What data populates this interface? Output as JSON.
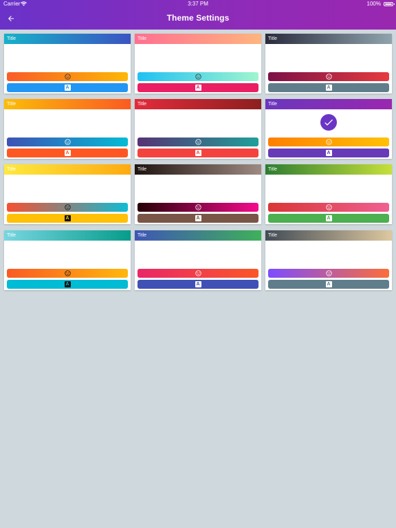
{
  "status": {
    "carrier": "Carrier",
    "time": "3:37 PM",
    "battery": "100%"
  },
  "header": {
    "title": "Theme Settings",
    "back_icon": "arrow-back-icon"
  },
  "themes": [
    {
      "title": "Title",
      "selected": false,
      "title_gradient": [
        "#17b1c9",
        "#3b54c2"
      ],
      "title_text": "#ffffff",
      "top_gradient": [
        "#f95c28",
        "#fdb706"
      ],
      "top_icon_color": "#333333",
      "bottom_gradient": [
        "#2196f3",
        "#2196f3"
      ],
      "bottom_icon_bg": "#ffffff",
      "bottom_icon_fg": "#2196f3"
    },
    {
      "title": "Title",
      "selected": false,
      "title_gradient": [
        "#ff6f91",
        "#ffb57f"
      ],
      "title_text": "#ffffff",
      "top_gradient": [
        "#21c1f3",
        "#9ff5cf"
      ],
      "top_icon_color": "#333333",
      "bottom_gradient": [
        "#e91e63",
        "#e91e63"
      ],
      "bottom_icon_bg": "#ffffff",
      "bottom_icon_fg": "#e91e63"
    },
    {
      "title": "Title",
      "selected": false,
      "title_gradient": [
        "#2a2b3c",
        "#90a4ae"
      ],
      "title_text": "#ffffff",
      "top_gradient": [
        "#7b1147",
        "#e63a3f"
      ],
      "top_icon_color": "#ffffff",
      "bottom_gradient": [
        "#607d8b",
        "#607d8b"
      ],
      "bottom_icon_bg": "#ffffff",
      "bottom_icon_fg": "#607d8b"
    },
    {
      "title": "Title",
      "selected": false,
      "title_gradient": [
        "#fbbd08",
        "#fb5a22"
      ],
      "title_text": "#ffffff",
      "top_gradient": [
        "#3f51b5",
        "#03bcd4"
      ],
      "top_icon_color": "#ffffff",
      "bottom_gradient": [
        "#ff5722",
        "#ff5722"
      ],
      "bottom_icon_bg": "#ffffff",
      "bottom_icon_fg": "#ff5722"
    },
    {
      "title": "Title",
      "selected": false,
      "title_gradient": [
        "#e32b3b",
        "#8d1f1f"
      ],
      "title_text": "#ffffff",
      "top_gradient": [
        "#563274",
        "#20a09a"
      ],
      "top_icon_color": "#ffffff",
      "bottom_gradient": [
        "#f4433e",
        "#f4433e"
      ],
      "bottom_icon_bg": "#ffffff",
      "bottom_icon_fg": "#f4433e"
    },
    {
      "title": "Title",
      "selected": true,
      "title_gradient": [
        "#6a37bd",
        "#9b27b0"
      ],
      "title_text": "#ffffff",
      "top_gradient": [
        "#fd7f01",
        "#ffc107"
      ],
      "top_icon_color": "#ffffff",
      "bottom_gradient": [
        "#673ab7",
        "#673ab7"
      ],
      "bottom_icon_bg": "#ffffff",
      "bottom_icon_fg": "#673ab7"
    },
    {
      "title": "Title",
      "selected": false,
      "title_gradient": [
        "#fde940",
        "#fdaa10"
      ],
      "title_text": "#ffffff",
      "top_gradient": [
        "#f75030",
        "#10bcd4"
      ],
      "top_icon_color": "#111111",
      "bottom_gradient": [
        "#ffc107",
        "#ffc107"
      ],
      "bottom_icon_bg": "#111111",
      "bottom_icon_fg": "#ffc107"
    },
    {
      "title": "Title",
      "selected": false,
      "title_gradient": [
        "#1f1410",
        "#9e8a82"
      ],
      "title_text": "#ffffff",
      "top_gradient": [
        "#270007",
        "#f50b8d"
      ],
      "top_icon_color": "#ffffff",
      "bottom_gradient": [
        "#795548",
        "#795548"
      ],
      "bottom_icon_bg": "#ffffff",
      "bottom_icon_fg": "#795548"
    },
    {
      "title": "Title",
      "selected": false,
      "title_gradient": [
        "#2e7d32",
        "#c6e03a"
      ],
      "title_text": "#ffffff",
      "top_gradient": [
        "#d93636",
        "#ef6191"
      ],
      "top_icon_color": "#ffffff",
      "bottom_gradient": [
        "#4caf50",
        "#4caf50"
      ],
      "bottom_icon_bg": "#ffffff",
      "bottom_icon_fg": "#4caf50"
    },
    {
      "title": "Title",
      "selected": false,
      "title_gradient": [
        "#78d6e0",
        "#079c8b"
      ],
      "title_text": "#ffffff",
      "top_gradient": [
        "#fa5a25",
        "#ffb80b"
      ],
      "top_icon_color": "#111111",
      "bottom_gradient": [
        "#00bcd4",
        "#00bcd4"
      ],
      "bottom_icon_bg": "#111111",
      "bottom_icon_fg": "#00bcd4"
    },
    {
      "title": "Title",
      "selected": false,
      "title_gradient": [
        "#3f56b5",
        "#3fb05a"
      ],
      "title_text": "#ffffff",
      "top_gradient": [
        "#e92868",
        "#fb5628"
      ],
      "top_icon_color": "#ffffff",
      "bottom_gradient": [
        "#3f51b5",
        "#3f51b5"
      ],
      "bottom_icon_bg": "#ffffff",
      "bottom_icon_fg": "#3f51b5"
    },
    {
      "title": "Title",
      "selected": false,
      "title_gradient": [
        "#424b55",
        "#ddc8a0"
      ],
      "title_text": "#ffffff",
      "top_gradient": [
        "#7c4dff",
        "#fc6d3a"
      ],
      "top_icon_color": "#ffffff",
      "bottom_gradient": [
        "#607d8b",
        "#607d8b"
      ],
      "bottom_icon_bg": "#ffffff",
      "bottom_icon_fg": "#607d8b"
    }
  ]
}
